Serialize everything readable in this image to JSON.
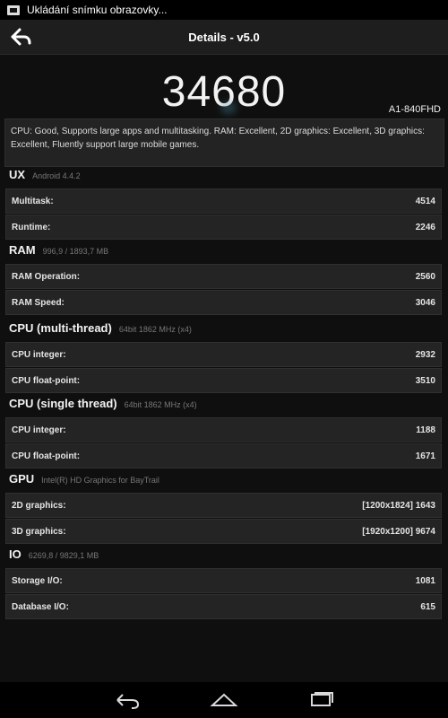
{
  "status_bar": {
    "notification_text": "Ukládání snímku obrazovky..."
  },
  "header": {
    "title": "Details - v5.0"
  },
  "score": "34680",
  "device_name": "A1-840FHD",
  "summary": "CPU: Good, Supports large apps and multitasking. RAM: Excellent, 2D graphics: Excellent, 3D graphics: Excellent, Fluently support large mobile games.",
  "sections": [
    {
      "title": "UX",
      "subtitle": "Android 4.4.2",
      "rows": [
        {
          "label": "Multitask:",
          "value": "4514"
        },
        {
          "label": "Runtime:",
          "value": "2246"
        }
      ]
    },
    {
      "title": "RAM",
      "subtitle": "996,9 / 1893,7 MB",
      "rows": [
        {
          "label": "RAM Operation:",
          "value": "2560"
        },
        {
          "label": "RAM Speed:",
          "value": "3046"
        }
      ]
    },
    {
      "title": "CPU (multi-thread)",
      "subtitle": "64bit 1862 MHz (x4)",
      "rows": [
        {
          "label": "CPU integer:",
          "value": "2932"
        },
        {
          "label": "CPU float-point:",
          "value": "3510"
        }
      ]
    },
    {
      "title": "CPU (single thread)",
      "subtitle": "64bit 1862 MHz (x4)",
      "rows": [
        {
          "label": "CPU integer:",
          "value": "1188"
        },
        {
          "label": "CPU float-point:",
          "value": "1671"
        }
      ]
    },
    {
      "title": "GPU",
      "subtitle": "Intel(R) HD Graphics for BayTrail",
      "rows": [
        {
          "label": "2D graphics:",
          "value": "[1200x1824] 1643"
        },
        {
          "label": "3D graphics:",
          "value": "[1920x1200] 9674"
        }
      ]
    },
    {
      "title": "IO",
      "subtitle": "6269,8 / 9829,1 MB",
      "rows": [
        {
          "label": "Storage I/O:",
          "value": "1081"
        },
        {
          "label": "Database I/O:",
          "value": "615"
        }
      ]
    }
  ],
  "icons": {
    "status": "screenshot-icon",
    "back": "back-arrow-icon",
    "nav_back": "back-nav-icon",
    "nav_home": "home-nav-icon",
    "nav_recent": "recent-apps-icon"
  }
}
